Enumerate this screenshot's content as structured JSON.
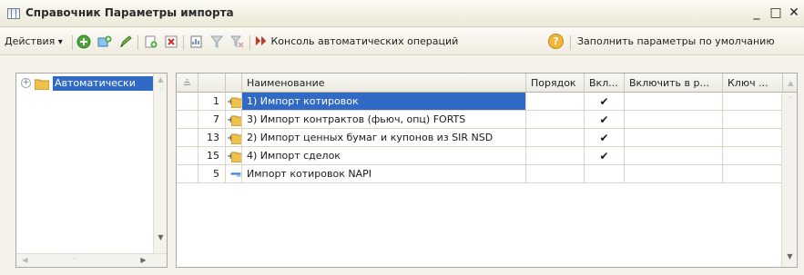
{
  "window": {
    "title": "Справочник Параметры импорта",
    "minimize": "_",
    "maximize": "□",
    "close": "✕"
  },
  "toolbar": {
    "actions_label": "Действия",
    "actions_arrow": "▾",
    "console_label": "Консоль автоматических операций",
    "help_glyph": "?",
    "fill_defaults_label": "Заполнить параметры по умолчанию"
  },
  "tree": {
    "root_label": "Автоматически",
    "expand_glyph": "+"
  },
  "grid": {
    "columns": [
      "Наименование",
      "Порядок",
      "Вкл...",
      "Включить в р...",
      "Ключ ..."
    ],
    "rows": [
      {
        "code": "1",
        "name": "1) Импорт котировок",
        "enabled": "✔",
        "expand": "+",
        "kind": "folder",
        "selected": true
      },
      {
        "code": "7",
        "name": "3) Импорт контрактов (фьюч, опц) FORTS",
        "enabled": "✔",
        "expand": "+",
        "kind": "folder",
        "selected": false
      },
      {
        "code": "13",
        "name": "2) Импорт ценных бумаг и купонов из SIR NSD",
        "enabled": "✔",
        "expand": "+",
        "kind": "folder",
        "selected": false
      },
      {
        "code": "15",
        "name": "4) Импорт сделок",
        "enabled": "✔",
        "expand": "+",
        "kind": "folder",
        "selected": false
      },
      {
        "code": "5",
        "name": "Импорт котировок NAPI",
        "enabled": "",
        "expand": "",
        "kind": "item",
        "selected": false
      }
    ]
  },
  "colors": {
    "selection": "#316ac5",
    "folder": "#f0c14b",
    "title_bg": "#ece9d8"
  },
  "icons": [
    "table-icon",
    "add-icon",
    "add-copy-icon",
    "edit-icon",
    "add-folder-icon",
    "delete-icon",
    "report-icon",
    "filter-icon",
    "clear-filter-icon",
    "console-icon",
    "help-icon",
    "folder-icon",
    "item-icon"
  ]
}
